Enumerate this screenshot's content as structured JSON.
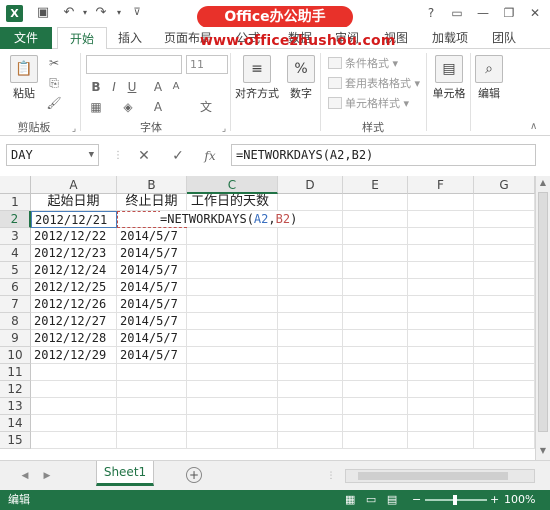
{
  "watermark": {
    "title": "Office办公助手",
    "url": "www.officezhushou.com"
  },
  "tabs": [
    "文件",
    "开始",
    "插入",
    "页面布局",
    "公式",
    "数据",
    "审阅",
    "视图",
    "加载项",
    "团队"
  ],
  "ribbon": {
    "paste": "粘贴",
    "font_size": "11",
    "alignment": "对齐方式",
    "number": "数字",
    "percent_symbol": "%",
    "conditional_format": "条件格式",
    "table_format": "套用表格格式",
    "cell_style": "单元格样式",
    "cells": "单元格",
    "editing": "编辑",
    "groups": {
      "clipboard": "剪贴板",
      "font": "字体",
      "styles": "样式"
    }
  },
  "formula_bar": {
    "name_box": "DAY",
    "formula": "=NETWORKDAYS(A2,B2)",
    "fx": "fx"
  },
  "columns": [
    "A",
    "B",
    "C",
    "D",
    "E",
    "F",
    "G"
  ],
  "rows": [
    "1",
    "2",
    "3",
    "4",
    "5",
    "6",
    "7",
    "8",
    "9",
    "10",
    "11",
    "12",
    "13",
    "14",
    "15"
  ],
  "table": {
    "headers": {
      "a": "起始日期",
      "b": "终止日期",
      "c": "工作日的天数"
    },
    "start_dates": [
      "2012/12/21",
      "2012/12/22",
      "2012/12/23",
      "2012/12/24",
      "2012/12/25",
      "2012/12/26",
      "2012/12/27",
      "2012/12/28",
      "2012/12/29"
    ],
    "end_dates": [
      "",
      "2014/5/7",
      "2014/5/7",
      "2014/5/7",
      "2014/5/7",
      "2014/5/7",
      "2014/5/7",
      "2014/5/7",
      "2014/5/7"
    ],
    "editing": {
      "prefix": "=NETWORKDAYS(",
      "ref_a": "A2",
      "comma": ",",
      "ref_b": "B2",
      "suffix": ")"
    }
  },
  "sheet": {
    "name": "Sheet1",
    "add": "+"
  },
  "status": {
    "mode": "编辑",
    "zoom": "100%",
    "minus": "−",
    "plus": "+"
  }
}
